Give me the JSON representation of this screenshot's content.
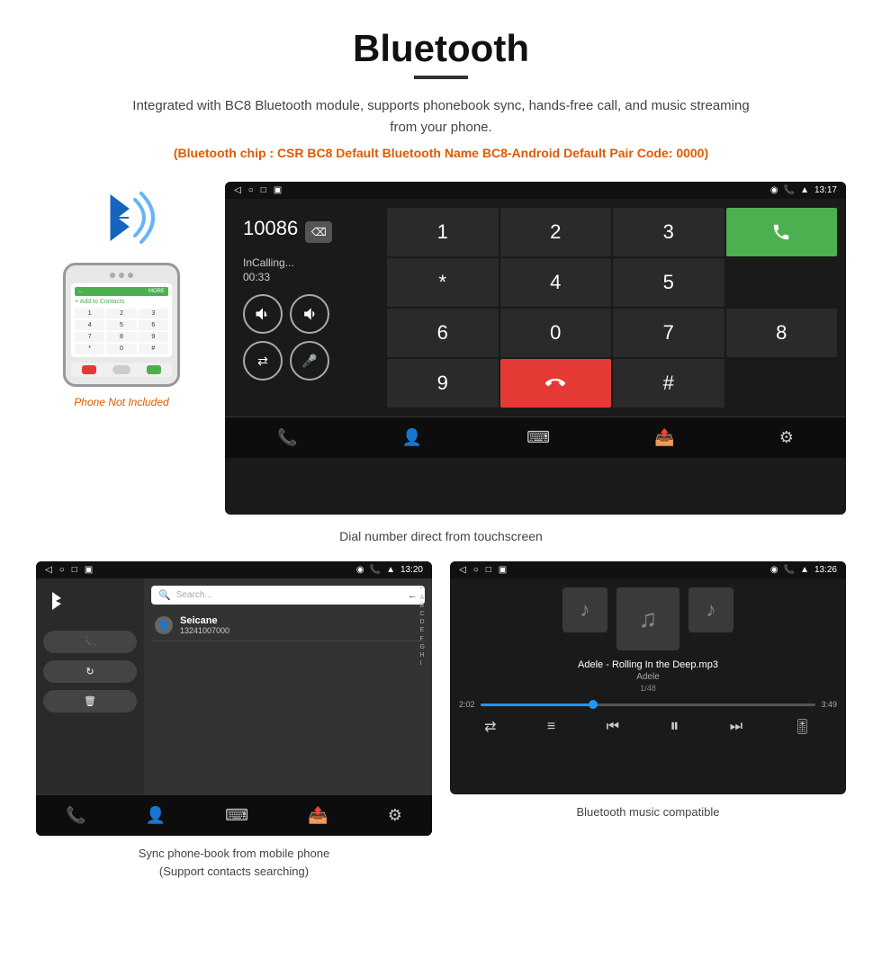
{
  "page": {
    "title": "Bluetooth",
    "description": "Integrated with BC8 Bluetooth module, supports phonebook sync, hands-free call, and music streaming from your phone.",
    "specs": "(Bluetooth chip : CSR BC8    Default Bluetooth Name BC8-Android    Default Pair Code: 0000)",
    "main_caption": "Dial number direct from touchscreen",
    "pb_caption": "Sync phone-book from mobile phone\n(Support contacts searching)",
    "music_caption": "Bluetooth music compatible",
    "phone_not_included": "Phone Not Included"
  },
  "dial_screen": {
    "status_left": [
      "◁",
      "○",
      "□",
      "▣"
    ],
    "status_right": [
      "📍",
      "📞",
      "▲",
      "13:17"
    ],
    "number": "10086",
    "in_calling": "InCalling...",
    "call_time": "00:33",
    "keys": [
      "1",
      "2",
      "3",
      "*",
      "4",
      "5",
      "6",
      "0",
      "7",
      "8",
      "9",
      "#"
    ]
  },
  "phonebook_screen": {
    "status_right": "13:20",
    "contact_name": "Seicane",
    "contact_number": "13241007000",
    "alphabet": [
      "*",
      "A",
      "B",
      "C",
      "D",
      "E",
      "F",
      "G",
      "H",
      "I"
    ]
  },
  "music_screen": {
    "status_right": "13:26",
    "song_title": "Adele - Rolling In the Deep.mp3",
    "artist": "Adele",
    "track": "1/48",
    "time_current": "2:02",
    "time_total": "3:49"
  }
}
